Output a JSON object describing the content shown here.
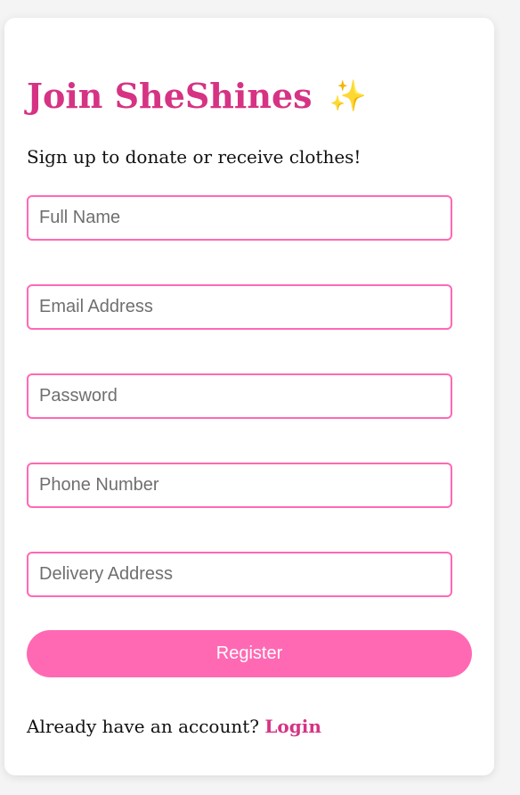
{
  "colors": {
    "accent": "#d63384",
    "button": "#ff69b4",
    "field_border": "#ff69b4",
    "sparkle": "#f4c430"
  },
  "header": {
    "title": "Join SheShines",
    "sparkle_glyph": "✨",
    "subtitle": "Sign up to donate or receive clothes!"
  },
  "form": {
    "full_name": {
      "value": "",
      "placeholder": "Full Name"
    },
    "email": {
      "value": "",
      "placeholder": "Email Address"
    },
    "password": {
      "value": "",
      "placeholder": "Password"
    },
    "phone": {
      "value": "",
      "placeholder": "Phone Number"
    },
    "address": {
      "value": "",
      "placeholder": "Delivery Address"
    },
    "submit_label": "Register"
  },
  "footer": {
    "prompt": "Already have an account?",
    "login_label": "Login"
  }
}
